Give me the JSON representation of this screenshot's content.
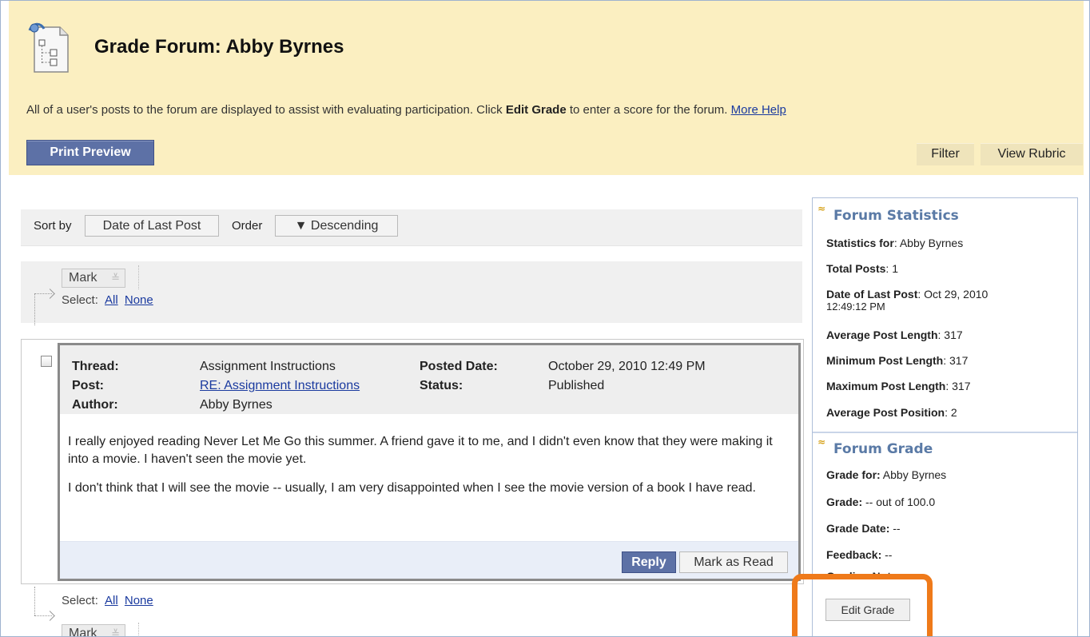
{
  "header": {
    "title": "Grade Forum: Abby Byrnes",
    "instructions_pre": "All of a user's posts to the forum are displayed to assist with evaluating participation. Click ",
    "instructions_bold": "Edit Grade",
    "instructions_post": " to enter a score for the forum. ",
    "more_help": "More Help",
    "print_preview": "Print Preview",
    "filter": "Filter",
    "view_rubric": "View Rubric"
  },
  "sort": {
    "sort_by_label": "Sort by",
    "sort_by_value": "Date of Last Post",
    "order_label": "Order",
    "order_value": "▼ Descending"
  },
  "mark_bar": {
    "mark_label": "Mark",
    "select_label": "Select:",
    "all": "All",
    "none": "None"
  },
  "post": {
    "thread_label": "Thread:",
    "thread_value": "Assignment Instructions",
    "post_label": "Post:",
    "post_value": "RE: Assignment Instructions",
    "author_label": "Author:",
    "author_value": "Abby Byrnes",
    "posted_date_label": "Posted Date:",
    "posted_date_value": "October 29, 2010 12:49 PM",
    "status_label": "Status:",
    "status_value": "Published",
    "body_p1": "I really enjoyed reading Never Let Me Go this summer.  A friend gave it to me, and I didn't even know that they were making it into a movie.  I haven't seen the movie yet.",
    "body_p2": "I don't think that I will see the movie -- usually, I am very disappointed when I see the movie version of a book I have read.",
    "reply": "Reply",
    "mark_as_read": "Mark as Read"
  },
  "stats": {
    "title": "Forum Statistics",
    "statistics_for_label": "Statistics for",
    "statistics_for_value": ": Abby Byrnes",
    "total_posts_label": "Total Posts",
    "total_posts_value": ": 1",
    "date_last_post_label": "Date of Last Post",
    "date_last_post_value": ": Oct 29, 2010",
    "date_last_post_time": "12:49:12 PM",
    "avg_len_label": "Average Post Length",
    "avg_len_value": ": 317",
    "min_len_label": "Minimum Post Length",
    "min_len_value": ": 317",
    "max_len_label": "Maximum Post Length",
    "max_len_value": ": 317",
    "avg_pos_label": "Average Post Position",
    "avg_pos_value": ": 2"
  },
  "grade": {
    "title": "Forum Grade",
    "grade_for_label": "Grade for:",
    "grade_for_value": " Abby Byrnes",
    "grade_label": "Grade:",
    "grade_value": " -- out of 100.0",
    "grade_date_label": "Grade Date:",
    "grade_date_value": "  --",
    "feedback_label": "Feedback:",
    "feedback_value": " --",
    "grading_notes_label": "Grading Notes:",
    "edit_grade": "Edit Grade"
  },
  "colors": {
    "header_bg": "#fbefc1",
    "primary_button": "#5d71a6",
    "highlight": "#ef7a1a",
    "link": "#1a3a9f"
  }
}
